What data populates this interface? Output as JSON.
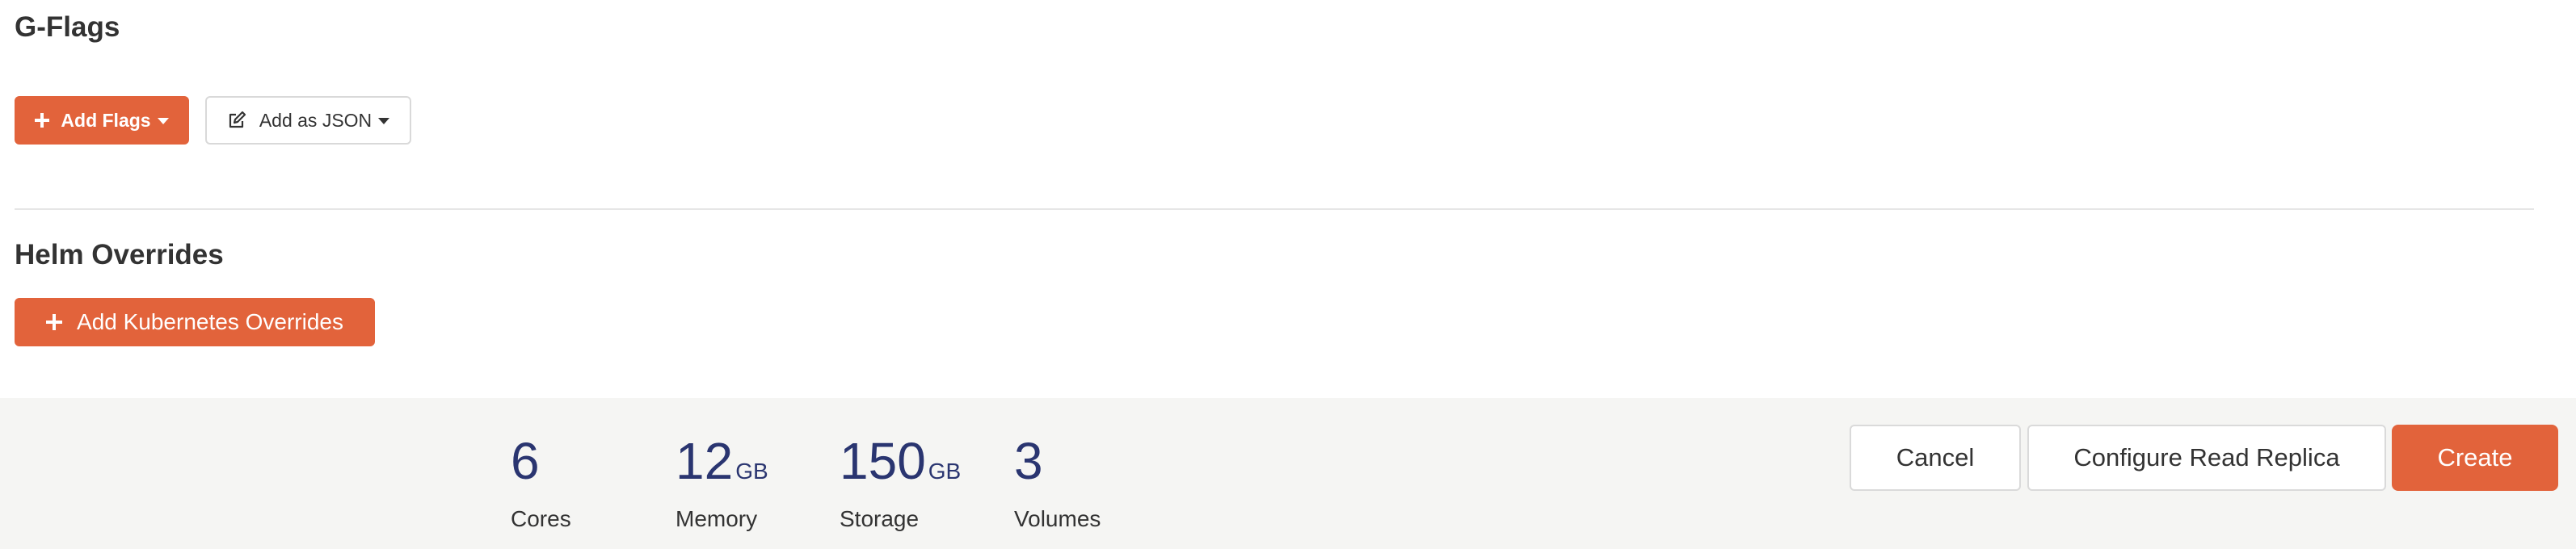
{
  "gflags": {
    "title": "G-Flags",
    "add_flags_label": "Add Flags",
    "add_json_label": "Add as JSON"
  },
  "helm": {
    "title": "Helm Overrides",
    "add_k8s_label": "Add Kubernetes Overrides"
  },
  "summary": {
    "cores": {
      "value": "6",
      "unit": "",
      "label": "Cores"
    },
    "memory": {
      "value": "12",
      "unit": "GB",
      "label": "Memory"
    },
    "storage": {
      "value": "150",
      "unit": "GB",
      "label": "Storage"
    },
    "volumes": {
      "value": "3",
      "unit": "",
      "label": "Volumes"
    }
  },
  "actions": {
    "cancel_label": "Cancel",
    "replica_label": "Configure Read Replica",
    "create_label": "Create"
  },
  "colors": {
    "accent": "#e2633b",
    "stat_value": "#2a3570",
    "footer_bg": "#f5f5f3"
  },
  "icons": [
    "plus-icon",
    "chevron-down-icon",
    "edit-icon"
  ]
}
